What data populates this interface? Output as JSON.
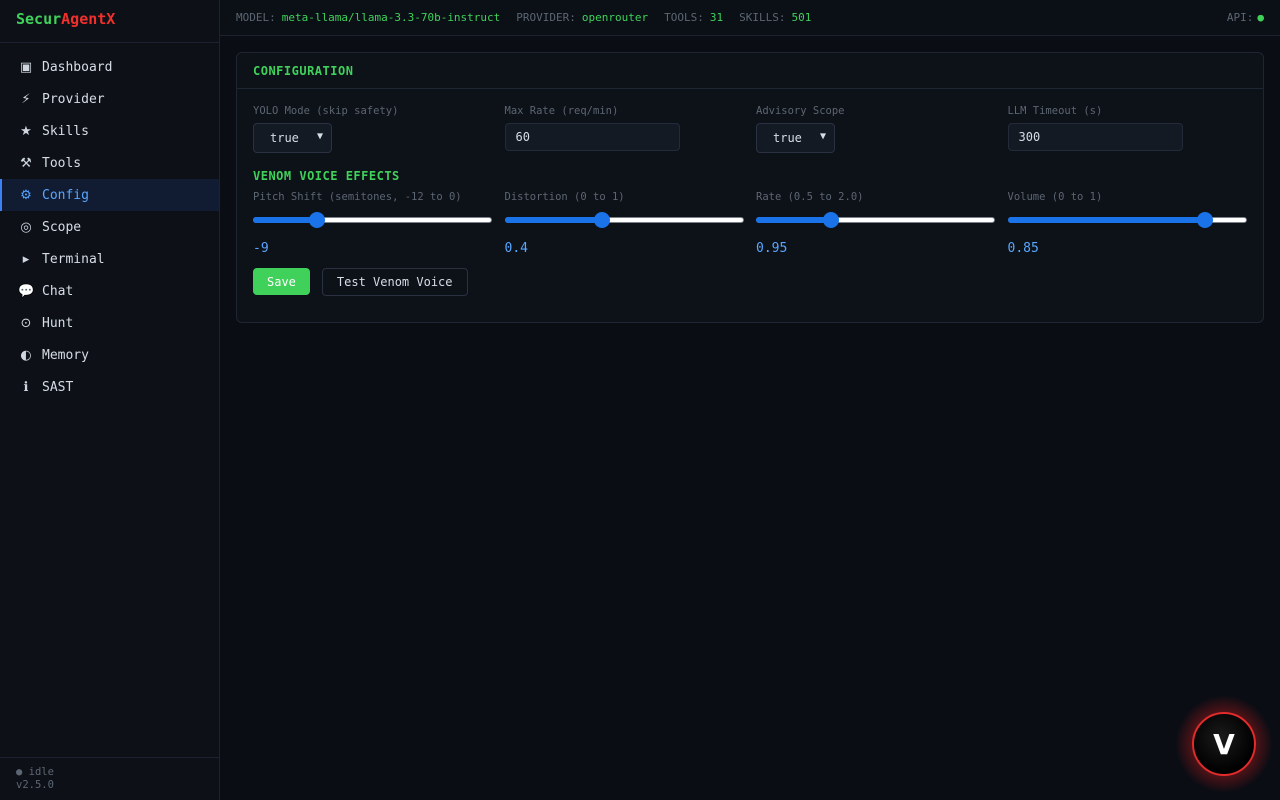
{
  "brand": {
    "part1": "Secur",
    "part2": "AgentX"
  },
  "sidebar": {
    "items": [
      {
        "label": "Dashboard",
        "icon": "▣",
        "icon_name": "dashboard-icon",
        "active": false
      },
      {
        "label": "Provider",
        "icon": "⚡",
        "icon_name": "lightning-icon",
        "active": false
      },
      {
        "label": "Skills",
        "icon": "★",
        "icon_name": "star-icon",
        "active": false
      },
      {
        "label": "Tools",
        "icon": "⚒",
        "icon_name": "hammer-icon",
        "active": false
      },
      {
        "label": "Config",
        "icon": "⚙",
        "icon_name": "gear-icon",
        "active": true
      },
      {
        "label": "Scope",
        "icon": "◎",
        "icon_name": "target-icon",
        "active": false
      },
      {
        "label": "Terminal",
        "icon": "▸",
        "icon_name": "terminal-icon",
        "active": false
      },
      {
        "label": "Chat",
        "icon": "💬",
        "icon_name": "chat-bubble-icon",
        "active": false
      },
      {
        "label": "Hunt",
        "icon": "⊙",
        "icon_name": "crosshair-icon",
        "active": false
      },
      {
        "label": "Memory",
        "icon": "◐",
        "icon_name": "memory-icon",
        "active": false
      },
      {
        "label": "SAST",
        "icon": "ℹ",
        "icon_name": "info-icon",
        "active": false
      }
    ],
    "status": "● idle",
    "version": "v2.5.0"
  },
  "topbar": {
    "model_key": "MODEL:",
    "model_val": "meta-llama/llama-3.3-70b-instruct",
    "provider_key": "PROVIDER:",
    "provider_val": "openrouter",
    "tools_key": "TOOLS:",
    "tools_val": "31",
    "skills_key": "SKILLS:",
    "skills_val": "501",
    "api_key": "API:",
    "api_dot": "●"
  },
  "config": {
    "title": "CONFIGURATION",
    "yolo": {
      "label": "YOLO Mode (skip safety)",
      "value": "true"
    },
    "max_rate": {
      "label": "Max Rate (req/min)",
      "value": "60"
    },
    "advisory": {
      "label": "Advisory Scope",
      "value": "true"
    },
    "timeout": {
      "label": "LLM Timeout (s)",
      "value": "300"
    },
    "venom_title": "VENOM VOICE EFFECTS",
    "sliders": [
      {
        "label": "Pitch Shift (semitones, -12 to 0)",
        "value": "-9",
        "min": -12,
        "max": 0,
        "num": -9
      },
      {
        "label": "Distortion (0 to 1)",
        "value": "0.4",
        "min": 0,
        "max": 1,
        "num": 0.4
      },
      {
        "label": "Rate (0.5 to 2.0)",
        "value": "0.95",
        "min": 0.5,
        "max": 2.0,
        "num": 0.95
      },
      {
        "label": "Volume (0 to 1)",
        "value": "0.85",
        "min": 0,
        "max": 1,
        "num": 0.85
      }
    ],
    "save_label": "Save",
    "test_label": "Test Venom Voice"
  },
  "fab": {
    "letter": "V"
  },
  "colors": {
    "accent_green": "#3fd15a",
    "accent_red": "#f0302c",
    "accent_blue": "#58a6ff",
    "slider_blue": "#1a73e8"
  }
}
